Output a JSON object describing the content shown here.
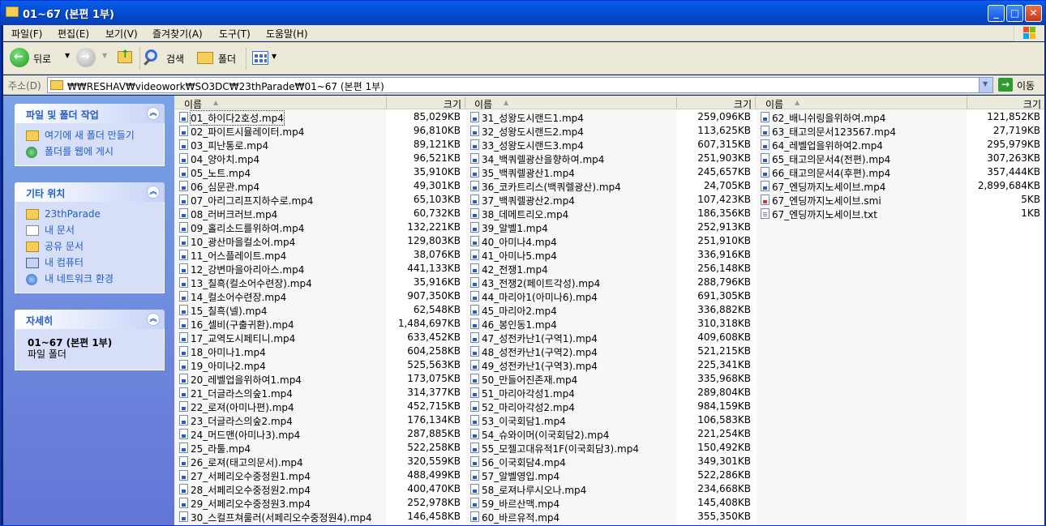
{
  "window": {
    "title": "01~67 (본편 1부)",
    "min_glyph": "_",
    "max_glyph": "□",
    "close_glyph": "✕"
  },
  "menu": [
    "파일(F)",
    "편집(E)",
    "보기(V)",
    "즐겨찾기(A)",
    "도구(T)",
    "도움말(H)"
  ],
  "toolbar": {
    "back": "뒤로",
    "search": "검색",
    "folders": "폴더"
  },
  "address": {
    "label": "주소(D)",
    "value": "₩₩RESHAV₩videowork₩SO3DC₩23thParade₩01~67 (본편 1부)",
    "go": "이동"
  },
  "left": {
    "tasks": {
      "title": "파일 및 폴더 작업",
      "items": [
        {
          "label": "여기에 새 폴더 만들기",
          "icon": "new-folder-icon"
        },
        {
          "label": "폴더를 웹에 게시",
          "icon": "publish-web-icon"
        }
      ]
    },
    "places": {
      "title": "기타 위치",
      "items": [
        {
          "label": "23thParade",
          "icon": "folder-icon"
        },
        {
          "label": "내 문서",
          "icon": "my-documents-icon"
        },
        {
          "label": "공유 문서",
          "icon": "shared-documents-icon"
        },
        {
          "label": "내 컴퓨터",
          "icon": "my-computer-icon"
        },
        {
          "label": "내 네트워크 환경",
          "icon": "network-icon"
        }
      ]
    },
    "details": {
      "title": "자세히",
      "name": "01~67 (본편 1부)",
      "type": "파일 폴더"
    }
  },
  "columns": {
    "name": "이름",
    "size": "크기"
  },
  "files": {
    "col1": [
      [
        "01_하이다2호성.mp4",
        "85,029KB"
      ],
      [
        "02_파이트시뮬레이터.mp4",
        "96,810KB"
      ],
      [
        "03_피난통로.mp4",
        "89,121KB"
      ],
      [
        "04_양아치.mp4",
        "96,521KB"
      ],
      [
        "05_노트.mp4",
        "35,910KB"
      ],
      [
        "06_심문관.mp4",
        "49,301KB"
      ],
      [
        "07_아리그리프지하수로.mp4",
        "65,103KB"
      ],
      [
        "08_러버크러브.mp4",
        "60,732KB"
      ],
      [
        "09_홀리소드를위하여.mp4",
        "132,221KB"
      ],
      [
        "10_광산마을컬소어.mp4",
        "129,803KB"
      ],
      [
        "11_어스플레이트.mp4",
        "38,076KB"
      ],
      [
        "12_강변마을아리아스.mp4",
        "441,133KB"
      ],
      [
        "13_칠흑(컬소어수련장).mp4",
        "35,916KB"
      ],
      [
        "14_컬소어수련장.mp4",
        "907,350KB"
      ],
      [
        "15_칠흑(넬).mp4",
        "62,548KB"
      ],
      [
        "16_셀비(구출귀환).mp4",
        "1,484,697KB"
      ],
      [
        "17_교역도시페티니.mp4",
        "633,452KB"
      ],
      [
        "18_아미나1.mp4",
        "604,258KB"
      ],
      [
        "19_아미나2.mp4",
        "525,563KB"
      ],
      [
        "20_레벨업을위하여1.mp4",
        "173,075KB"
      ],
      [
        "21_더글라스의숲1.mp4",
        "314,377KB"
      ],
      [
        "22_로져(아미나편).mp4",
        "452,715KB"
      ],
      [
        "23_더글라스의숲2.mp4",
        "176,134KB"
      ],
      [
        "24_머드맨(아미나3).mp4",
        "287,885KB"
      ],
      [
        "25_라툴.mp4",
        "522,258KB"
      ],
      [
        "26_로져(태고의문서).mp4",
        "320,559KB"
      ],
      [
        "27_서페리오수중정원1.mp4",
        "488,499KB"
      ],
      [
        "28_서페리오수중정원2.mp4",
        "400,470KB"
      ],
      [
        "29_서페리오수중정원3.mp4",
        "252,978KB"
      ],
      [
        "30_스컬프쳐룰러(서페리오수중정원4).mp4",
        "146,458KB"
      ]
    ],
    "col2": [
      [
        "31_성왕도시랜드1.mp4",
        "259,096KB"
      ],
      [
        "32_성왕도시랜드2.mp4",
        "113,625KB"
      ],
      [
        "33_성왕도시랜드3.mp4",
        "607,315KB"
      ],
      [
        "34_백쿼렐광산을향하여.mp4",
        "251,903KB"
      ],
      [
        "35_백쿼렐광산1.mp4",
        "245,657KB"
      ],
      [
        "36_코카트리스(백쿼렐광산).mp4",
        "24,705KB"
      ],
      [
        "37_백쿼렐광산2.mp4",
        "107,423KB"
      ],
      [
        "38_데메트리오.mp4",
        "186,356KB"
      ],
      [
        "39_알벨1.mp4",
        "252,913KB"
      ],
      [
        "40_아미나4.mp4",
        "251,910KB"
      ],
      [
        "41_아미나5.mp4",
        "336,916KB"
      ],
      [
        "42_전쟁1.mp4",
        "256,148KB"
      ],
      [
        "43_전쟁2(페이트각성).mp4",
        "288,796KB"
      ],
      [
        "44_마리아1(아미나6).mp4",
        "691,305KB"
      ],
      [
        "45_마리아2.mp4",
        "336,882KB"
      ],
      [
        "46_봉인동1.mp4",
        "310,318KB"
      ],
      [
        "47_성전카난1(구역1).mp4",
        "409,608KB"
      ],
      [
        "48_성전카난1(구역2).mp4",
        "521,215KB"
      ],
      [
        "49_성전카난1(구역3).mp4",
        "225,341KB"
      ],
      [
        "50_만들어진존재.mp4",
        "335,968KB"
      ],
      [
        "51_마리아각성1.mp4",
        "289,804KB"
      ],
      [
        "52_마리아각성2.mp4",
        "984,159KB"
      ],
      [
        "53_이국회담1.mp4",
        "106,583KB"
      ],
      [
        "54_슈와이머(이국회담2).mp4",
        "221,254KB"
      ],
      [
        "55_모젤고대유적1F(이국회담3).mp4",
        "150,492KB"
      ],
      [
        "56_이국회담4.mp4",
        "349,301KB"
      ],
      [
        "57_알벨영입.mp4",
        "522,286KB"
      ],
      [
        "58_로져나루시오나.mp4",
        "234,668KB"
      ],
      [
        "59_바르산맥.mp4",
        "145,408KB"
      ],
      [
        "60_바르유적.mp4",
        "355,350KB"
      ]
    ],
    "col3": [
      [
        "62_배니쉬링을위하여.mp4",
        "121,852KB",
        "mp4"
      ],
      [
        "63_태고의문서123567.mp4",
        "27,719KB",
        "mp4"
      ],
      [
        "64_레벨업을위하여2.mp4",
        "295,979KB",
        "mp4"
      ],
      [
        "65_태고의문서4(전편).mp4",
        "307,263KB",
        "mp4"
      ],
      [
        "66_태고의문서4(후편).mp4",
        "357,444KB",
        "mp4"
      ],
      [
        "67_엔딩까지노세이브.mp4",
        "2,899,684KB",
        "mp4"
      ],
      [
        "67_엔딩까지노세이브.smi",
        "5KB",
        "smi"
      ],
      [
        "67_엔딩까지노세이브.txt",
        "1KB",
        "txt"
      ]
    ]
  }
}
